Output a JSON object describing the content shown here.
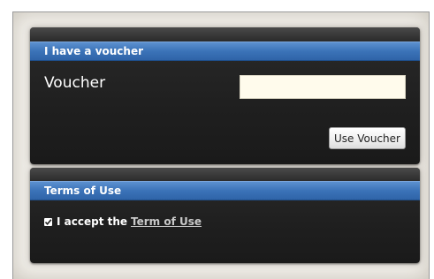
{
  "voucher_panel": {
    "header": "I have a voucher",
    "label": "Voucher",
    "input_value": "",
    "button_label": "Use Voucher"
  },
  "terms_panel": {
    "header": "Terms of Use",
    "checkbox_checked": true,
    "accept_text": "I accept the",
    "link_text": "Term of Use"
  },
  "colors": {
    "header_blue": "#3b73b8",
    "panel_dark": "#1f1f1f",
    "input_bg": "#fffbec"
  },
  "icons": {
    "checkbox": "checkmark-icon"
  }
}
